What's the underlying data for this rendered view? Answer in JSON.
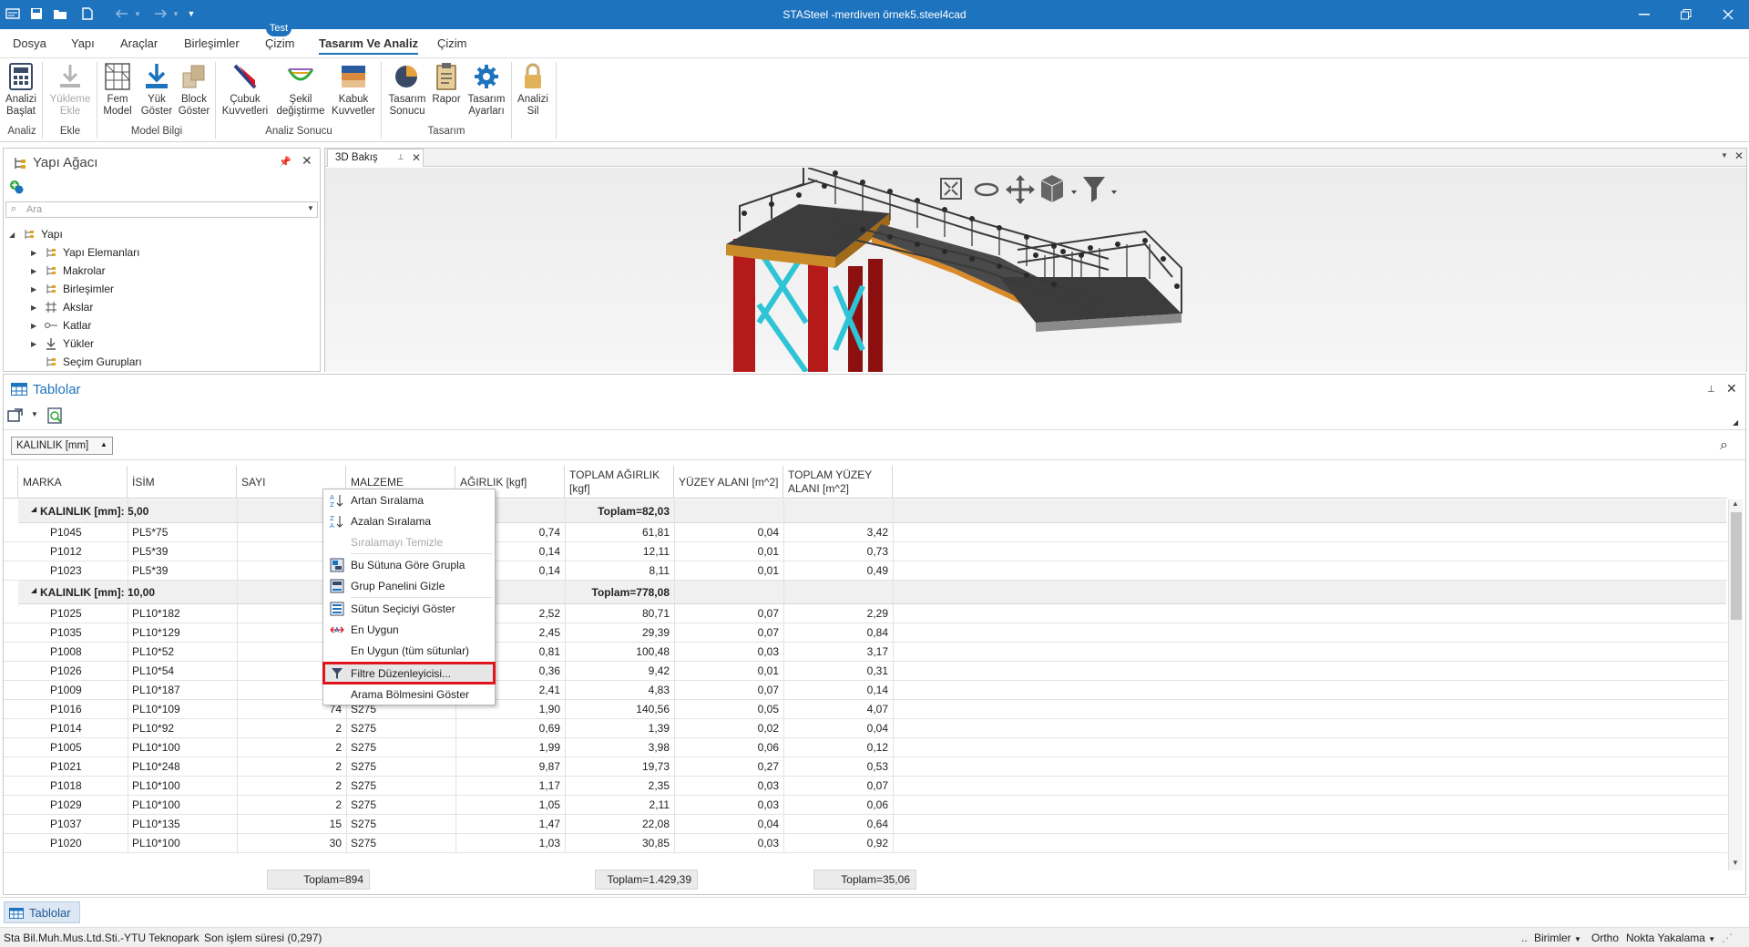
{
  "window": {
    "title": "STASteel -merdiven örnek5.steel4cad"
  },
  "menu": {
    "items": [
      "Dosya",
      "Yapı",
      "Araçlar",
      "Birleşimler",
      "Çizim",
      "Tasarım Ve Analiz",
      "Çizim"
    ],
    "badge": "Test"
  },
  "ribbon": {
    "buttons": [
      {
        "line1": "Analizi",
        "line2": "Başlat"
      },
      {
        "line1": "Yükleme",
        "line2": "Ekle"
      },
      {
        "line1": "Fem",
        "line2": "Model"
      },
      {
        "line1": "Yük",
        "line2": "Göster"
      },
      {
        "line1": "Block",
        "line2": "Göster"
      },
      {
        "line1": "Çubuk",
        "line2": "Kuvvetleri"
      },
      {
        "line1": "Şekil",
        "line2": "değiştirme"
      },
      {
        "line1": "Kabuk",
        "line2": "Kuvvetler"
      },
      {
        "line1": "Tasarım",
        "line2": "Sonucu"
      },
      {
        "line1": "Rapor",
        "line2": ""
      },
      {
        "line1": "Tasarım",
        "line2": "Ayarları"
      },
      {
        "line1": "Analizi",
        "line2": "Sil"
      }
    ],
    "groups": [
      "Analiz",
      "Ekle",
      "Model Bilgi",
      "Analiz Sonucu",
      "Tasarım"
    ]
  },
  "tree_panel": {
    "title": "Yapı Ağacı",
    "search_placeholder": "Ara",
    "root": "Yapı",
    "items": [
      "Yapı Elemanları",
      "Makrolar",
      "Birleşimler",
      "Akslar",
      "Katlar",
      "Yükler",
      "Seçim Gurupları"
    ]
  },
  "view_tab": {
    "label": "3D Bakış"
  },
  "tables_panel": {
    "title": "Tablolar",
    "group_chip": "KALINLIK [mm]",
    "columns": [
      "MARKA",
      "İSİM",
      "SAYI",
      "MALZEME",
      "AĞIRLIK [kgf]",
      "TOPLAM AĞIRLIK [kgf]",
      "YÜZEY ALANI [m^2]",
      "TOPLAM YÜZEY ALANI [m^2]"
    ],
    "groups": [
      {
        "label": "KALINLIK [mm]: 5,00",
        "total": "Toplam=82,03",
        "rows": [
          {
            "marka": "P1045",
            "isim": "PL5*75",
            "sayi": "",
            "malzeme": "",
            "agirlik": "0,74",
            "toplam_agirlik": "61,81",
            "yuzey": "0,04",
            "toplam_yuzey": "3,42"
          },
          {
            "marka": "P1012",
            "isim": "PL5*39",
            "sayi": "",
            "malzeme": "",
            "agirlik": "0,14",
            "toplam_agirlik": "12,11",
            "yuzey": "0,01",
            "toplam_yuzey": "0,73"
          },
          {
            "marka": "P1023",
            "isim": "PL5*39",
            "sayi": "",
            "malzeme": "",
            "agirlik": "0,14",
            "toplam_agirlik": "8,11",
            "yuzey": "0,01",
            "toplam_yuzey": "0,49"
          }
        ]
      },
      {
        "label": "KALINLIK [mm]: 10,00",
        "total": "Toplam=778,08",
        "rows": [
          {
            "marka": "P1025",
            "isim": "PL10*182",
            "sayi": "",
            "malzeme": "",
            "agirlik": "2,52",
            "toplam_agirlik": "80,71",
            "yuzey": "0,07",
            "toplam_yuzey": "2,29"
          },
          {
            "marka": "P1035",
            "isim": "PL10*129",
            "sayi": "",
            "malzeme": "",
            "agirlik": "2,45",
            "toplam_agirlik": "29,39",
            "yuzey": "0,07",
            "toplam_yuzey": "0,84"
          },
          {
            "marka": "P1008",
            "isim": "PL10*52",
            "sayi": "",
            "malzeme": "",
            "agirlik": "0,81",
            "toplam_agirlik": "100,48",
            "yuzey": "0,03",
            "toplam_yuzey": "3,17"
          },
          {
            "marka": "P1026",
            "isim": "PL10*54",
            "sayi": "",
            "malzeme": "",
            "agirlik": "0,36",
            "toplam_agirlik": "9,42",
            "yuzey": "0,01",
            "toplam_yuzey": "0,31"
          },
          {
            "marka": "P1009",
            "isim": "PL10*187",
            "sayi": "",
            "malzeme": "",
            "agirlik": "2,41",
            "toplam_agirlik": "4,83",
            "yuzey": "0,07",
            "toplam_yuzey": "0,14"
          },
          {
            "marka": "P1016",
            "isim": "PL10*109",
            "sayi": "74",
            "malzeme": "S275",
            "agirlik": "1,90",
            "toplam_agirlik": "140,56",
            "yuzey": "0,05",
            "toplam_yuzey": "4,07"
          },
          {
            "marka": "P1014",
            "isim": "PL10*92",
            "sayi": "2",
            "malzeme": "S275",
            "agirlik": "0,69",
            "toplam_agirlik": "1,39",
            "yuzey": "0,02",
            "toplam_yuzey": "0,04"
          },
          {
            "marka": "P1005",
            "isim": "PL10*100",
            "sayi": "2",
            "malzeme": "S275",
            "agirlik": "1,99",
            "toplam_agirlik": "3,98",
            "yuzey": "0,06",
            "toplam_yuzey": "0,12"
          },
          {
            "marka": "P1021",
            "isim": "PL10*248",
            "sayi": "2",
            "malzeme": "S275",
            "agirlik": "9,87",
            "toplam_agirlik": "19,73",
            "yuzey": "0,27",
            "toplam_yuzey": "0,53"
          },
          {
            "marka": "P1018",
            "isim": "PL10*100",
            "sayi": "2",
            "malzeme": "S275",
            "agirlik": "1,17",
            "toplam_agirlik": "2,35",
            "yuzey": "0,03",
            "toplam_yuzey": "0,07"
          },
          {
            "marka": "P1029",
            "isim": "PL10*100",
            "sayi": "2",
            "malzeme": "S275",
            "agirlik": "1,05",
            "toplam_agirlik": "2,11",
            "yuzey": "0,03",
            "toplam_yuzey": "0,06"
          },
          {
            "marka": "P1037",
            "isim": "PL10*135",
            "sayi": "15",
            "malzeme": "S275",
            "agirlik": "1,47",
            "toplam_agirlik": "22,08",
            "yuzey": "0,04",
            "toplam_yuzey": "0,64"
          },
          {
            "marka": "P1020",
            "isim": "PL10*100",
            "sayi": "30",
            "malzeme": "S275",
            "agirlik": "1,03",
            "toplam_agirlik": "30,85",
            "yuzey": "0,03",
            "toplam_yuzey": "0,92"
          }
        ]
      }
    ],
    "footer": {
      "sayi": "Toplam=894",
      "toplam_agirlik": "Toplam=1.429,39",
      "toplam_yuzey": "Toplam=35,06"
    }
  },
  "context_menu": {
    "items": [
      "Artan Sıralama",
      "Azalan Sıralama",
      "Sıralamayı Temizle",
      "Bu Sütuna Göre Grupla",
      "Grup Panelini Gizle",
      "Sütun Seçiciyi Göster",
      "En Uygun",
      "En Uygun (tüm sütunlar)",
      "Filtre Düzenleyicisi...",
      "Arama Bölmesini Göster"
    ]
  },
  "bottom_tab": {
    "label": "Tablolar"
  },
  "statusbar": {
    "company": "Sta Bil.Muh.Mus.Ltd.Sti.-YTU Teknopark",
    "last_op": "Son işlem süresi (0,297)",
    "units": "Birimler",
    "ortho": "Ortho",
    "snap": "Nokta Yakalama"
  },
  "colors": {
    "accent": "#1e73be",
    "highlight": "#e0141e"
  }
}
